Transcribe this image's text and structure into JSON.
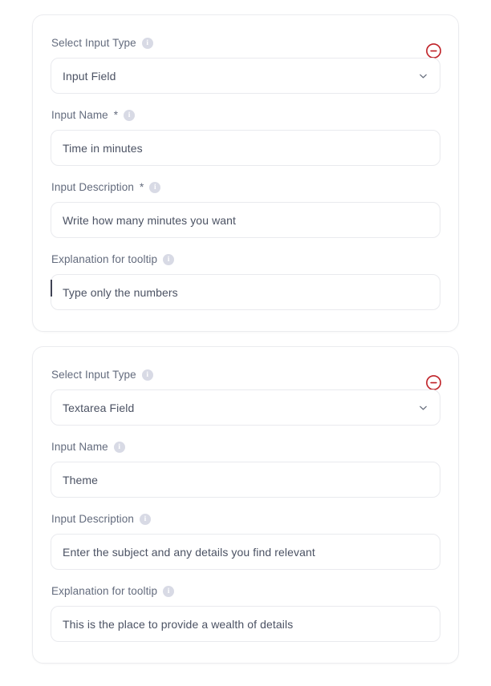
{
  "theme": {
    "background": "#ffffff",
    "card_background": "#ffffff",
    "card_border": "#ebecef",
    "label_color": "#636b7d",
    "value_color": "#4b5263",
    "input_border": "#e9eaee",
    "remove_icon_color": "#bf2026",
    "info_icon_color": "#d8dae5"
  },
  "cards": [
    {
      "remove_icon": "minus-circle-icon",
      "fields": [
        {
          "label": "Select Input Type",
          "required": false,
          "info_icon": "info-icon",
          "type": "select",
          "value": "Input Field",
          "placeholder": "Select Input Type",
          "chevron_icon": "chevron-down-icon",
          "options": [
            "Input Field",
            "Textarea Field"
          ],
          "focused": false
        },
        {
          "label": "Input Name",
          "required": true,
          "required_marker": "*",
          "info_icon": "info-icon",
          "type": "text",
          "value": "Time in minutes",
          "placeholder": "Input Name",
          "focused": false
        },
        {
          "label": "Input Description",
          "required": true,
          "required_marker": "*",
          "info_icon": "info-icon",
          "type": "text",
          "value": "Write how many minutes you want",
          "placeholder": "Input Description",
          "focused": false
        },
        {
          "label": "Explanation for tooltip",
          "required": false,
          "info_icon": "info-icon",
          "type": "text",
          "value": "Type only the numbers",
          "placeholder": "Explanation for tooltip",
          "focused": true
        }
      ]
    },
    {
      "remove_icon": "minus-circle-icon",
      "fields": [
        {
          "label": "Select Input Type",
          "required": false,
          "info_icon": "info-icon",
          "type": "select",
          "value": "Textarea Field",
          "placeholder": "Select Input Type",
          "chevron_icon": "chevron-down-icon",
          "options": [
            "Input Field",
            "Textarea Field"
          ],
          "focused": false
        },
        {
          "label": "Input Name",
          "required": false,
          "info_icon": "info-icon",
          "type": "text",
          "value": "Theme",
          "placeholder": "Input Name",
          "focused": false
        },
        {
          "label": "Input Description",
          "required": false,
          "info_icon": "info-icon",
          "type": "text",
          "value": "Enter the subject and any details you find relevant",
          "placeholder": "Input Description",
          "focused": false
        },
        {
          "label": "Explanation for tooltip",
          "required": false,
          "info_icon": "info-icon",
          "type": "text",
          "value": "This is the place to provide a wealth of details",
          "placeholder": "Explanation for tooltip",
          "focused": false
        }
      ]
    }
  ],
  "icons": {
    "info_glyph": "i"
  }
}
